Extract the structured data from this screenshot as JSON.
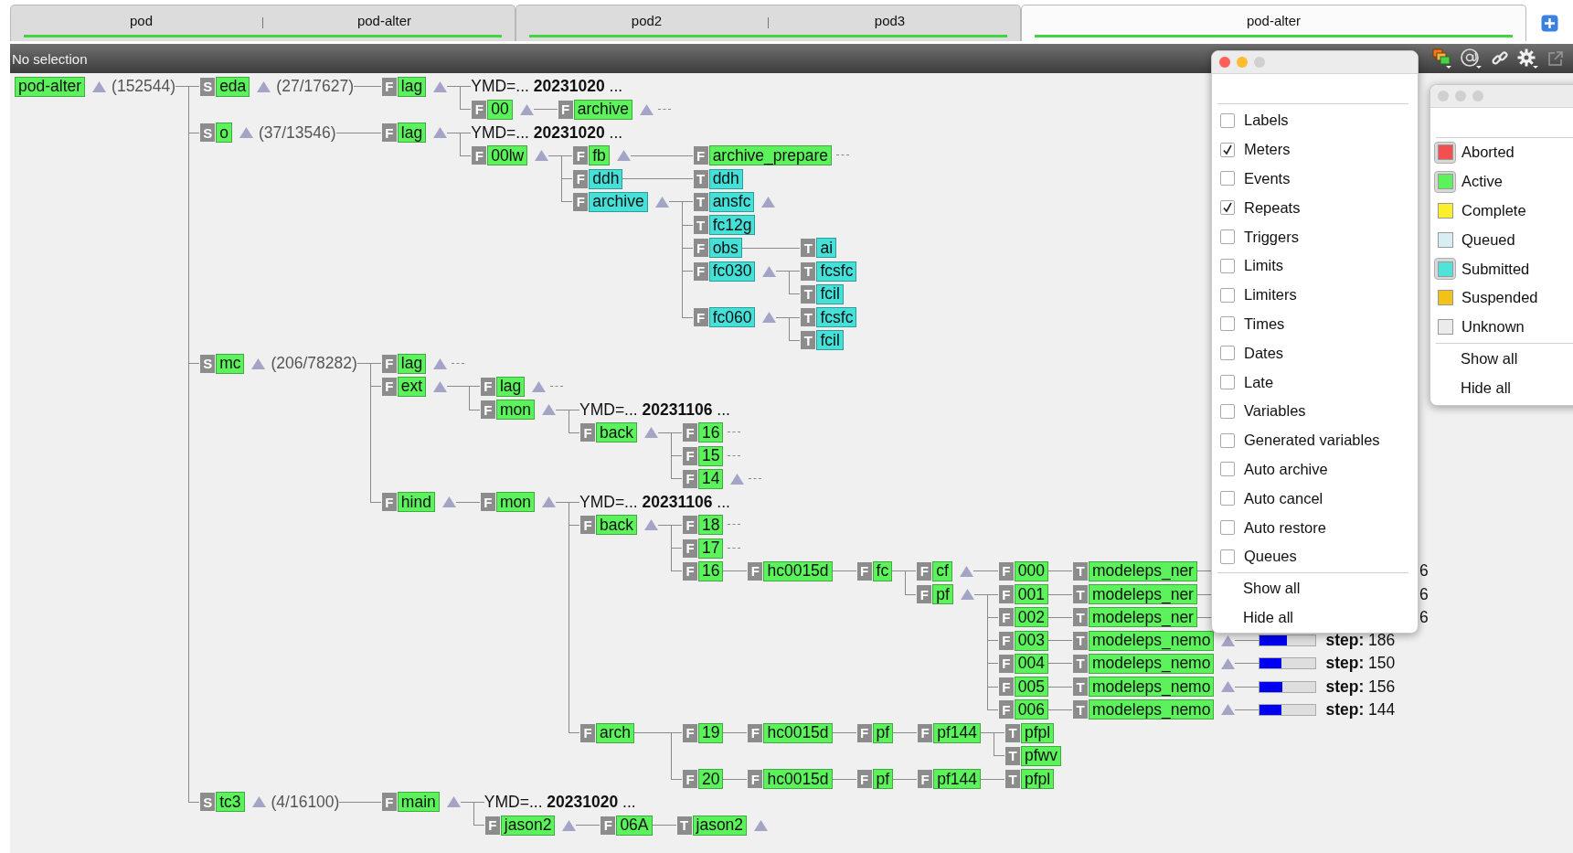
{
  "tabs": [
    {
      "servers": [
        {
          "name": "pod"
        },
        {
          "name": "pod-alter"
        }
      ],
      "selected": false
    },
    {
      "servers": [
        {
          "name": "pod2"
        },
        {
          "name": "pod3"
        }
      ],
      "selected": false
    },
    {
      "servers": [
        {
          "name": "pod-alter"
        }
      ],
      "selected": true
    }
  ],
  "info_bar": {
    "text": "No selection"
  },
  "tree": {
    "kind": "server",
    "name": "pod-alter",
    "color": "#5cf25c",
    "arrow": true,
    "count": "(152544)",
    "children": [
      {
        "kind": "node",
        "type": "S",
        "name": "eda",
        "color": "#5cf25c",
        "arrow": true,
        "count": "(27/17627)",
        "children": [
          {
            "kind": "node",
            "type": "F",
            "name": "lag",
            "color": "#5cf25c",
            "arrow": true,
            "children": [
              {
                "kind": "repeat",
                "text": "YMD=... **20231020** ..."
              },
              {
                "kind": "node",
                "type": "F",
                "name": "00",
                "color": "#5cf25c",
                "arrow": true,
                "children": [
                  {
                    "kind": "node",
                    "type": "F",
                    "name": "archive",
                    "color": "#5cf25c",
                    "arrow": true,
                    "dashes": true
                  }
                ]
              }
            ]
          }
        ]
      },
      {
        "kind": "node",
        "type": "S",
        "name": "o",
        "color": "#5cf25c",
        "arrow": true,
        "count": "(37/13546)",
        "children": [
          {
            "kind": "node",
            "type": "F",
            "name": "lag",
            "color": "#5cf25c",
            "arrow": true,
            "children": [
              {
                "kind": "repeat",
                "text": "YMD=... **20231020** ..."
              },
              {
                "kind": "node",
                "type": "F",
                "name": "00lw",
                "color": "#5cf25c",
                "arrow": true,
                "children": [
                  {
                    "kind": "node",
                    "type": "F",
                    "name": "fb",
                    "color": "#5cf25c",
                    "arrow": true,
                    "children": [
                      {
                        "kind": "node",
                        "type": "F",
                        "name": "archive_prepare",
                        "color": "#5cf25c",
                        "dashes": true
                      }
                    ]
                  },
                  {
                    "kind": "node",
                    "type": "F",
                    "name": "ddh",
                    "color": "#45e0d8",
                    "children": [
                      {
                        "kind": "node",
                        "type": "T",
                        "name": "ddh",
                        "color": "#45e0d8"
                      }
                    ]
                  },
                  {
                    "kind": "node",
                    "type": "F",
                    "name": "archive",
                    "color": "#45e0d8",
                    "arrow": true,
                    "children": [
                      {
                        "kind": "node",
                        "type": "T",
                        "name": "ansfc",
                        "color": "#45e0d8",
                        "arrow": true
                      },
                      {
                        "kind": "node",
                        "type": "T",
                        "name": "fc12g",
                        "color": "#45e0d8"
                      },
                      {
                        "kind": "node",
                        "type": "F",
                        "name": "obs",
                        "color": "#45e0d8",
                        "children": [
                          {
                            "kind": "node",
                            "type": "T",
                            "name": "ai",
                            "color": "#45e0d8"
                          }
                        ]
                      },
                      {
                        "kind": "node",
                        "type": "F",
                        "name": "fc030",
                        "color": "#45e0d8",
                        "arrow": true,
                        "children": [
                          {
                            "kind": "node",
                            "type": "T",
                            "name": "fcsfc",
                            "color": "#45e0d8"
                          },
                          {
                            "kind": "node",
                            "type": "T",
                            "name": "fcil",
                            "color": "#45e0d8"
                          }
                        ]
                      },
                      {
                        "kind": "node",
                        "type": "F",
                        "name": "fc060",
                        "color": "#45e0d8",
                        "arrow": true,
                        "children": [
                          {
                            "kind": "node",
                            "type": "T",
                            "name": "fcsfc",
                            "color": "#45e0d8"
                          },
                          {
                            "kind": "node",
                            "type": "T",
                            "name": "fcil",
                            "color": "#45e0d8"
                          }
                        ]
                      }
                    ]
                  }
                ]
              }
            ]
          }
        ]
      },
      {
        "kind": "node",
        "type": "S",
        "name": "mc",
        "color": "#5cf25c",
        "arrow": true,
        "count": "(206/78282)",
        "children": [
          {
            "kind": "node",
            "type": "F",
            "name": "lag",
            "color": "#5cf25c",
            "arrow": true,
            "dashes": true
          },
          {
            "kind": "node",
            "type": "F",
            "name": "ext",
            "color": "#5cf25c",
            "arrow": true,
            "children": [
              {
                "kind": "node",
                "type": "F",
                "name": "lag",
                "color": "#5cf25c",
                "arrow": true,
                "dashes": true
              },
              {
                "kind": "node",
                "type": "F",
                "name": "mon",
                "color": "#5cf25c",
                "arrow": true,
                "children": [
                  {
                    "kind": "repeat",
                    "text": "YMD=... **20231106** ..."
                  },
                  {
                    "kind": "node",
                    "type": "F",
                    "name": "back",
                    "color": "#5cf25c",
                    "arrow": true,
                    "children": [
                      {
                        "kind": "node",
                        "type": "F",
                        "name": "16",
                        "color": "#5cf25c",
                        "dashes": true
                      },
                      {
                        "kind": "node",
                        "type": "F",
                        "name": "15",
                        "color": "#5cf25c",
                        "dashes": true
                      },
                      {
                        "kind": "node",
                        "type": "F",
                        "name": "14",
                        "color": "#5cf25c",
                        "arrow": true,
                        "dashes": true
                      }
                    ]
                  }
                ]
              }
            ]
          },
          {
            "kind": "node",
            "type": "F",
            "name": "hind",
            "color": "#5cf25c",
            "arrow": true,
            "children": [
              {
                "kind": "node",
                "type": "F",
                "name": "mon",
                "color": "#5cf25c",
                "arrow": true,
                "children": [
                  {
                    "kind": "repeat",
                    "text": "YMD=... **20231106** ..."
                  },
                  {
                    "kind": "node",
                    "type": "F",
                    "name": "back",
                    "color": "#5cf25c",
                    "arrow": true,
                    "children": [
                      {
                        "kind": "node",
                        "type": "F",
                        "name": "18",
                        "color": "#5cf25c",
                        "dashes": true
                      },
                      {
                        "kind": "node",
                        "type": "F",
                        "name": "17",
                        "color": "#5cf25c",
                        "dashes": true
                      },
                      {
                        "kind": "node",
                        "type": "F",
                        "name": "16",
                        "color": "#5cf25c",
                        "children": [
                          {
                            "kind": "node",
                            "type": "F",
                            "name": "hc0015d",
                            "color": "#5cf25c",
                            "children": [
                              {
                                "kind": "node",
                                "type": "F",
                                "name": "fc",
                                "color": "#5cf25c",
                                "children": [
                                  {
                                    "kind": "node",
                                    "type": "F",
                                    "name": "cf",
                                    "color": "#5cf25c",
                                    "arrow": true,
                                    "children": [
                                      {
                                        "kind": "node",
                                        "type": "F",
                                        "name": "000",
                                        "color": "#5cf25c",
                                        "children": [
                                          {
                                            "kind": "node",
                                            "type": "T",
                                            "name": "modeleps_ner",
                                            "color": "#5cf25c",
                                            "children": [
                                              {
                                                "kind": "fragment",
                                                "text": "6"
                                              }
                                            ]
                                          }
                                        ]
                                      }
                                    ]
                                  },
                                  {
                                    "kind": "node",
                                    "type": "F",
                                    "name": "pf",
                                    "color": "#5cf25c",
                                    "arrow": true,
                                    "children": [
                                      {
                                        "kind": "node",
                                        "type": "F",
                                        "name": "001",
                                        "color": "#5cf25c",
                                        "children": [
                                          {
                                            "kind": "node",
                                            "type": "T",
                                            "name": "modeleps_ner",
                                            "color": "#5cf25c",
                                            "children": [
                                              {
                                                "kind": "fragment",
                                                "text": "6"
                                              }
                                            ]
                                          }
                                        ]
                                      },
                                      {
                                        "kind": "node",
                                        "type": "F",
                                        "name": "002",
                                        "color": "#5cf25c",
                                        "children": [
                                          {
                                            "kind": "node",
                                            "type": "T",
                                            "name": "modeleps_ner",
                                            "color": "#5cf25c",
                                            "children": [
                                              {
                                                "kind": "fragment",
                                                "text": "6"
                                              }
                                            ]
                                          }
                                        ]
                                      },
                                      {
                                        "kind": "node",
                                        "type": "F",
                                        "name": "003",
                                        "color": "#5cf25c",
                                        "children": [
                                          {
                                            "kind": "node",
                                            "type": "T",
                                            "name": "modeleps_nemo",
                                            "color": "#5cf25c",
                                            "arrow": true,
                                            "children": [
                                              {
                                                "kind": "meter",
                                                "level": 0.49,
                                                "reading": "**step:** 186"
                                              }
                                            ]
                                          }
                                        ]
                                      },
                                      {
                                        "kind": "node",
                                        "type": "F",
                                        "name": "004",
                                        "color": "#5cf25c",
                                        "children": [
                                          {
                                            "kind": "node",
                                            "type": "T",
                                            "name": "modeleps_nemo",
                                            "color": "#5cf25c",
                                            "arrow": true,
                                            "children": [
                                              {
                                                "kind": "meter",
                                                "level": 0.38,
                                                "reading": "**step:** 150"
                                              }
                                            ]
                                          }
                                        ]
                                      },
                                      {
                                        "kind": "node",
                                        "type": "F",
                                        "name": "005",
                                        "color": "#5cf25c",
                                        "children": [
                                          {
                                            "kind": "node",
                                            "type": "T",
                                            "name": "modeleps_nemo",
                                            "color": "#5cf25c",
                                            "arrow": true,
                                            "children": [
                                              {
                                                "kind": "meter",
                                                "level": 0.4,
                                                "reading": "**step:** 156"
                                              }
                                            ]
                                          }
                                        ]
                                      },
                                      {
                                        "kind": "node",
                                        "type": "F",
                                        "name": "006",
                                        "color": "#5cf25c",
                                        "children": [
                                          {
                                            "kind": "node",
                                            "type": "T",
                                            "name": "modeleps_nemo",
                                            "color": "#5cf25c",
                                            "arrow": true,
                                            "children": [
                                              {
                                                "kind": "meter",
                                                "level": 0.38,
                                                "reading": "**step:** 144"
                                              }
                                            ]
                                          }
                                        ]
                                      }
                                    ]
                                  }
                                ]
                              }
                            ]
                          }
                        ]
                      }
                    ]
                  },
                  {
                    "kind": "node",
                    "type": "F",
                    "name": "arch",
                    "color": "#5cf25c",
                    "children": [
                      {
                        "kind": "node",
                        "type": "F",
                        "name": "19",
                        "color": "#5cf25c",
                        "children": [
                          {
                            "kind": "node",
                            "type": "F",
                            "name": "hc0015d",
                            "color": "#5cf25c",
                            "children": [
                              {
                                "kind": "node",
                                "type": "F",
                                "name": "pf",
                                "color": "#5cf25c",
                                "children": [
                                  {
                                    "kind": "node",
                                    "type": "F",
                                    "name": "pf144",
                                    "color": "#5cf25c",
                                    "children": [
                                      {
                                        "kind": "node",
                                        "type": "T",
                                        "name": "pfpl",
                                        "color": "#5cf25c"
                                      },
                                      {
                                        "kind": "node",
                                        "type": "T",
                                        "name": "pfwv",
                                        "color": "#5cf25c"
                                      }
                                    ]
                                  }
                                ]
                              }
                            ]
                          }
                        ]
                      },
                      {
                        "kind": "node",
                        "type": "F",
                        "name": "20",
                        "color": "#5cf25c",
                        "children": [
                          {
                            "kind": "node",
                            "type": "F",
                            "name": "hc0015d",
                            "color": "#5cf25c",
                            "children": [
                              {
                                "kind": "node",
                                "type": "F",
                                "name": "pf",
                                "color": "#5cf25c",
                                "children": [
                                  {
                                    "kind": "node",
                                    "type": "F",
                                    "name": "pf144",
                                    "color": "#5cf25c",
                                    "children": [
                                      {
                                        "kind": "node",
                                        "type": "T",
                                        "name": "pfpl",
                                        "color": "#5cf25c"
                                      }
                                    ]
                                  }
                                ]
                              }
                            ]
                          }
                        ]
                      }
                    ]
                  }
                ]
              }
            ]
          }
        ]
      },
      {
        "kind": "node",
        "type": "S",
        "name": "tc3",
        "color": "#5cf25c",
        "arrow": true,
        "count": "(4/16100)",
        "children": [
          {
            "kind": "node",
            "type": "F",
            "name": "main",
            "color": "#5cf25c",
            "arrow": true,
            "children": [
              {
                "kind": "repeat",
                "text": "YMD=... **20231020** ..."
              },
              {
                "kind": "node",
                "type": "F",
                "name": "jason2",
                "color": "#5cf25c",
                "arrow": true,
                "children": [
                  {
                    "kind": "node",
                    "type": "F",
                    "name": "06A",
                    "color": "#5cf25c",
                    "children": [
                      {
                        "kind": "node",
                        "type": "T",
                        "name": "jason2",
                        "color": "#5cf25c",
                        "arrow": true
                      }
                    ]
                  }
                ]
              }
            ]
          }
        ]
      }
    ]
  },
  "attribute_filter": {
    "active": true,
    "items": [
      {
        "label": "Labels",
        "checked": false
      },
      {
        "label": "Meters",
        "checked": true
      },
      {
        "label": "Events",
        "checked": false
      },
      {
        "label": "Repeats",
        "checked": true
      },
      {
        "label": "Triggers",
        "checked": false
      },
      {
        "label": "Limits",
        "checked": false
      },
      {
        "label": "Limiters",
        "checked": false
      },
      {
        "label": "Times",
        "checked": false
      },
      {
        "label": "Dates",
        "checked": false
      },
      {
        "label": "Late",
        "checked": false
      },
      {
        "label": "Variables",
        "checked": false
      },
      {
        "label": "Generated variables",
        "checked": false
      },
      {
        "label": "Auto archive",
        "checked": false
      },
      {
        "label": "Auto cancel",
        "checked": false
      },
      {
        "label": "Auto restore",
        "checked": false
      },
      {
        "label": "Queues",
        "checked": false
      }
    ],
    "actions": [
      "Show all",
      "Hide all"
    ]
  },
  "state_filter": {
    "active": false,
    "items": [
      {
        "label": "Aborted",
        "color": "#f25050",
        "checked": true
      },
      {
        "label": "Active",
        "color": "#5cf25c",
        "checked": true
      },
      {
        "label": "Complete",
        "color": "#fbee2c",
        "checked": false
      },
      {
        "label": "Queued",
        "color": "#d8eef4",
        "checked": false
      },
      {
        "label": "Submitted",
        "color": "#4fe3da",
        "checked": true
      },
      {
        "label": "Suspended",
        "color": "#f2c11a",
        "checked": false
      },
      {
        "label": "Unknown",
        "color": "#ebebeb",
        "checked": false
      }
    ],
    "actions": [
      "Show all",
      "Hide all"
    ]
  }
}
